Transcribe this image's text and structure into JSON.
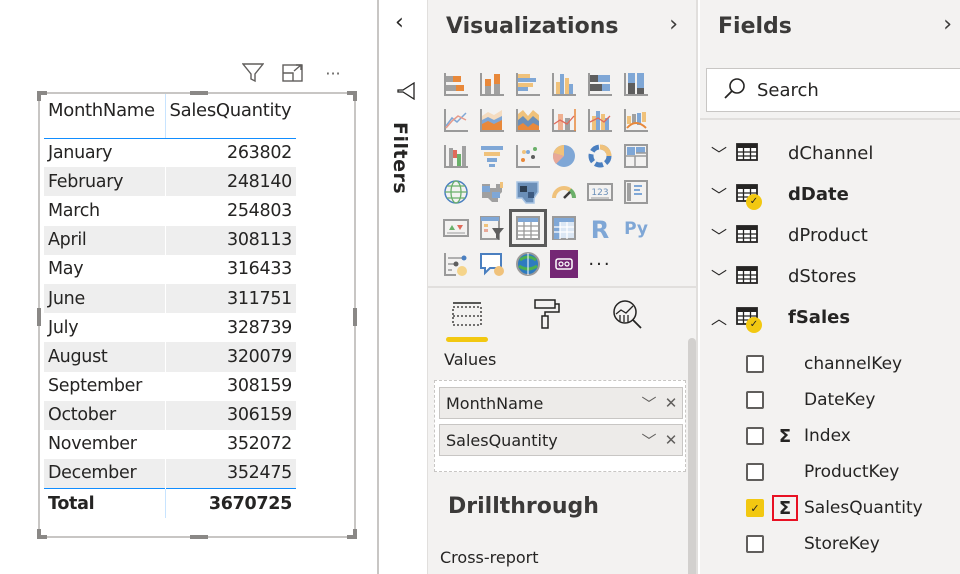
{
  "canvas": {
    "visual_header": {
      "filter_icon": "filter-icon",
      "focus_icon": "focus-mode-icon",
      "more_label": "···"
    },
    "table": {
      "columns": [
        "MonthName",
        "SalesQuantity"
      ],
      "rows": [
        [
          "January",
          "263802"
        ],
        [
          "February",
          "248140"
        ],
        [
          "March",
          "254803"
        ],
        [
          "April",
          "308113"
        ],
        [
          "May",
          "316433"
        ],
        [
          "June",
          "311751"
        ],
        [
          "July",
          "328739"
        ],
        [
          "August",
          "320079"
        ],
        [
          "September",
          "308159"
        ],
        [
          "October",
          "306159"
        ],
        [
          "November",
          "352072"
        ],
        [
          "December",
          "352475"
        ]
      ],
      "total": [
        "Total",
        "3670725"
      ]
    }
  },
  "filters": {
    "collapse_label": "‹",
    "label": "Filters"
  },
  "visualizations": {
    "title": "Visualizations",
    "chevron": "›",
    "icons": [
      "stacked-bar-chart",
      "stacked-column-chart",
      "clustered-bar-chart",
      "clustered-column-chart",
      "100-stacked-bar-chart",
      "100-stacked-column-chart",
      "line-chart",
      "area-chart",
      "stacked-area-chart",
      "line-and-stacked-column-chart",
      "line-and-clustered-column-chart",
      "ribbon-chart",
      "waterfall-chart",
      "funnel",
      "scatter-chart",
      "pie-chart",
      "donut-chart",
      "treemap",
      "map",
      "filled-map",
      "shape-map",
      "gauge",
      "card",
      "multi-row-card",
      "kpi",
      "slicer",
      "table",
      "matrix",
      "r-script-visual",
      "python-visual",
      "key-influencers",
      "q-and-a",
      "arcgis-map",
      "power-apps",
      "more-visuals"
    ],
    "selected_icon": "table",
    "tabs": [
      "fields-tab",
      "format-tab",
      "analytics-tab"
    ],
    "values_label": "Values",
    "value_fields": [
      "MonthName",
      "SalesQuantity"
    ],
    "drillthrough_label": "Drillthrough",
    "cross_report_label": "Cross-report"
  },
  "fields": {
    "title": "Fields",
    "chevron": "›",
    "search_placeholder": "Search",
    "tables": [
      {
        "name": "dChannel",
        "expanded": false,
        "has_selection": false
      },
      {
        "name": "dDate",
        "expanded": false,
        "has_selection": true
      },
      {
        "name": "dProduct",
        "expanded": false,
        "has_selection": false
      },
      {
        "name": "dStores",
        "expanded": false,
        "has_selection": false
      },
      {
        "name": "fSales",
        "expanded": true,
        "has_selection": true
      }
    ],
    "fsales_fields": [
      {
        "name": "channelKey",
        "checked": false,
        "sigma": false
      },
      {
        "name": "DateKey",
        "checked": false,
        "sigma": false
      },
      {
        "name": "Index",
        "checked": false,
        "sigma": true
      },
      {
        "name": "ProductKey",
        "checked": false,
        "sigma": false
      },
      {
        "name": "SalesQuantity",
        "checked": true,
        "sigma": true,
        "highlighted": true
      },
      {
        "name": "StoreKey",
        "checked": false,
        "sigma": false
      }
    ],
    "sigma_glyph": "Σ",
    "check_glyph": "✓"
  },
  "colors": {
    "accent_yellow": "#f2c811",
    "table_header_line": "#118dff",
    "highlight_red": "#e81123",
    "pane_bg": "#f3f2f1"
  }
}
